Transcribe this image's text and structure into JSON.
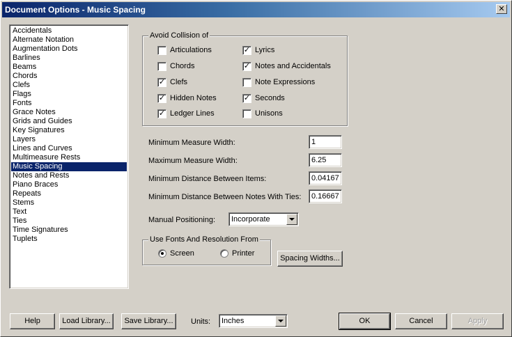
{
  "window": {
    "title": "Document Options - Music Spacing",
    "close_glyph": "✕"
  },
  "sidebar": {
    "items": [
      {
        "label": "Accidentals",
        "selected": false
      },
      {
        "label": "Alternate Notation",
        "selected": false
      },
      {
        "label": "Augmentation Dots",
        "selected": false
      },
      {
        "label": "Barlines",
        "selected": false
      },
      {
        "label": "Beams",
        "selected": false
      },
      {
        "label": "Chords",
        "selected": false
      },
      {
        "label": "Clefs",
        "selected": false
      },
      {
        "label": "Flags",
        "selected": false
      },
      {
        "label": "Fonts",
        "selected": false
      },
      {
        "label": "Grace Notes",
        "selected": false
      },
      {
        "label": "Grids and Guides",
        "selected": false
      },
      {
        "label": "Key Signatures",
        "selected": false
      },
      {
        "label": "Layers",
        "selected": false
      },
      {
        "label": "Lines and Curves",
        "selected": false
      },
      {
        "label": "Multimeasure Rests",
        "selected": false
      },
      {
        "label": "Music Spacing",
        "selected": true
      },
      {
        "label": "Notes and Rests",
        "selected": false
      },
      {
        "label": "Piano Braces",
        "selected": false
      },
      {
        "label": "Repeats",
        "selected": false
      },
      {
        "label": "Stems",
        "selected": false
      },
      {
        "label": "Text",
        "selected": false
      },
      {
        "label": "Ties",
        "selected": false
      },
      {
        "label": "Time Signatures",
        "selected": false
      },
      {
        "label": "Tuplets",
        "selected": false
      }
    ]
  },
  "avoid_collision": {
    "title": "Avoid Collision of",
    "left": [
      {
        "label": "Articulations",
        "checked": false
      },
      {
        "label": "Chords",
        "checked": false
      },
      {
        "label": "Clefs",
        "checked": true
      },
      {
        "label": "Hidden Notes",
        "checked": true
      },
      {
        "label": "Ledger Lines",
        "checked": true
      }
    ],
    "right": [
      {
        "label": "Lyrics",
        "checked": true
      },
      {
        "label": "Notes and Accidentals",
        "checked": true
      },
      {
        "label": "Note Expressions",
        "checked": false
      },
      {
        "label": "Seconds",
        "checked": true
      },
      {
        "label": "Unisons",
        "checked": false
      }
    ]
  },
  "fields": {
    "min_measure_width": {
      "label": "Minimum Measure Width:",
      "value": "1"
    },
    "max_measure_width": {
      "label": "Maximum Measure Width:",
      "value": "6.25"
    },
    "min_distance_items": {
      "label": "Minimum Distance Between Items:",
      "value": "0.04167"
    },
    "min_distance_ties": {
      "label": "Minimum Distance Between Notes With Ties:",
      "value": "0.16667"
    }
  },
  "manual_positioning": {
    "label": "Manual Positioning:",
    "value": "Incorporate"
  },
  "fonts_resolution": {
    "title": "Use Fonts And Resolution From",
    "screen_label": "Screen",
    "printer_label": "Printer",
    "selected": "Screen"
  },
  "spacing_widths_button": "Spacing Widths...",
  "footer": {
    "help": "Help",
    "load_library": "Load Library...",
    "save_library": "Save Library...",
    "units_label": "Units:",
    "units_value": "Inches",
    "ok": "OK",
    "cancel": "Cancel",
    "apply": "Apply"
  }
}
